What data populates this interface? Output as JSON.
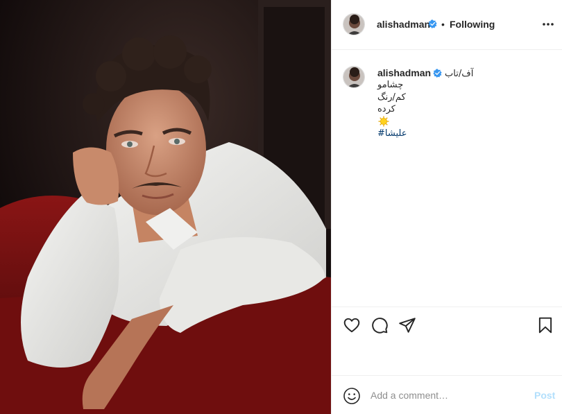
{
  "post": {
    "author": {
      "username": "alishadman",
      "verified": true,
      "avatar_icon": "profile-photo"
    },
    "follow_separator": "•",
    "follow_status": "Following",
    "more_icon": "more-horizontal-icon",
    "photo_description_icon": "post-photo",
    "caption": {
      "username": "alishadman",
      "lines": [
        "آف/تاب",
        "چشامو",
        "کم/رنگ",
        "کرده"
      ],
      "emoji": "sun-emoji",
      "hashtag": "#علیشا"
    },
    "actions": {
      "like_icon": "heart-icon",
      "comment_icon": "comment-icon",
      "share_icon": "paper-plane-icon",
      "save_icon": "bookmark-icon"
    },
    "add_comment": {
      "emoji_icon": "smiley-icon",
      "placeholder": "Add a comment…",
      "post_label": "Post"
    }
  },
  "colors": {
    "verified_blue": "#3897f0",
    "hashtag": "#00376b",
    "post_disabled": "#b2dffc",
    "border": "#efefef"
  }
}
